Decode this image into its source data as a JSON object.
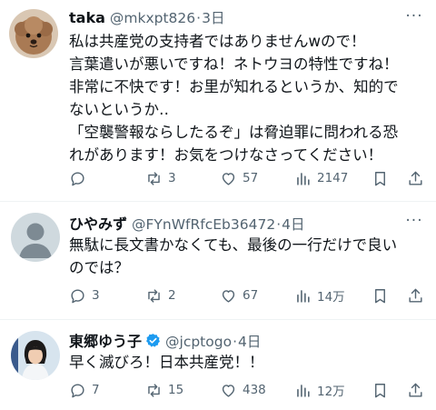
{
  "posts": [
    {
      "name": "taka",
      "handle": "@mkxpt826",
      "time": "3日",
      "lines": [
        "私は共産党の支持者ではありませんwので！",
        "言葉遣いが悪いですね！ネトウヨの特性ですね！",
        "非常に不快です！お里が知れるというか、知的で",
        "ないというか‥",
        "「空襲警報ならしたるぞ」は脅迫罪に問われる恐",
        "れがあります！お気をつけなさってください！"
      ],
      "replies": "",
      "reposts": "3",
      "likes": "57",
      "views": "2147"
    },
    {
      "name": "ひやみず",
      "handle": "@FYnWfRfcEb36472",
      "time": "4日",
      "lines": [
        "無駄に長文書かなくても、最後の一行だけで良い",
        "のでは？"
      ],
      "replies": "3",
      "reposts": "2",
      "likes": "67",
      "views": "14万"
    },
    {
      "name": "東郷ゆう子",
      "handle": "@jcptogo",
      "time": "4日",
      "lines": [
        "早く滅びろ！日本共産党！！"
      ],
      "replies": "7",
      "reposts": "15",
      "likes": "438",
      "views": "12万"
    }
  ],
  "icons": {
    "verified_color": "#1d9bf0",
    "action_color": "#536471"
  }
}
